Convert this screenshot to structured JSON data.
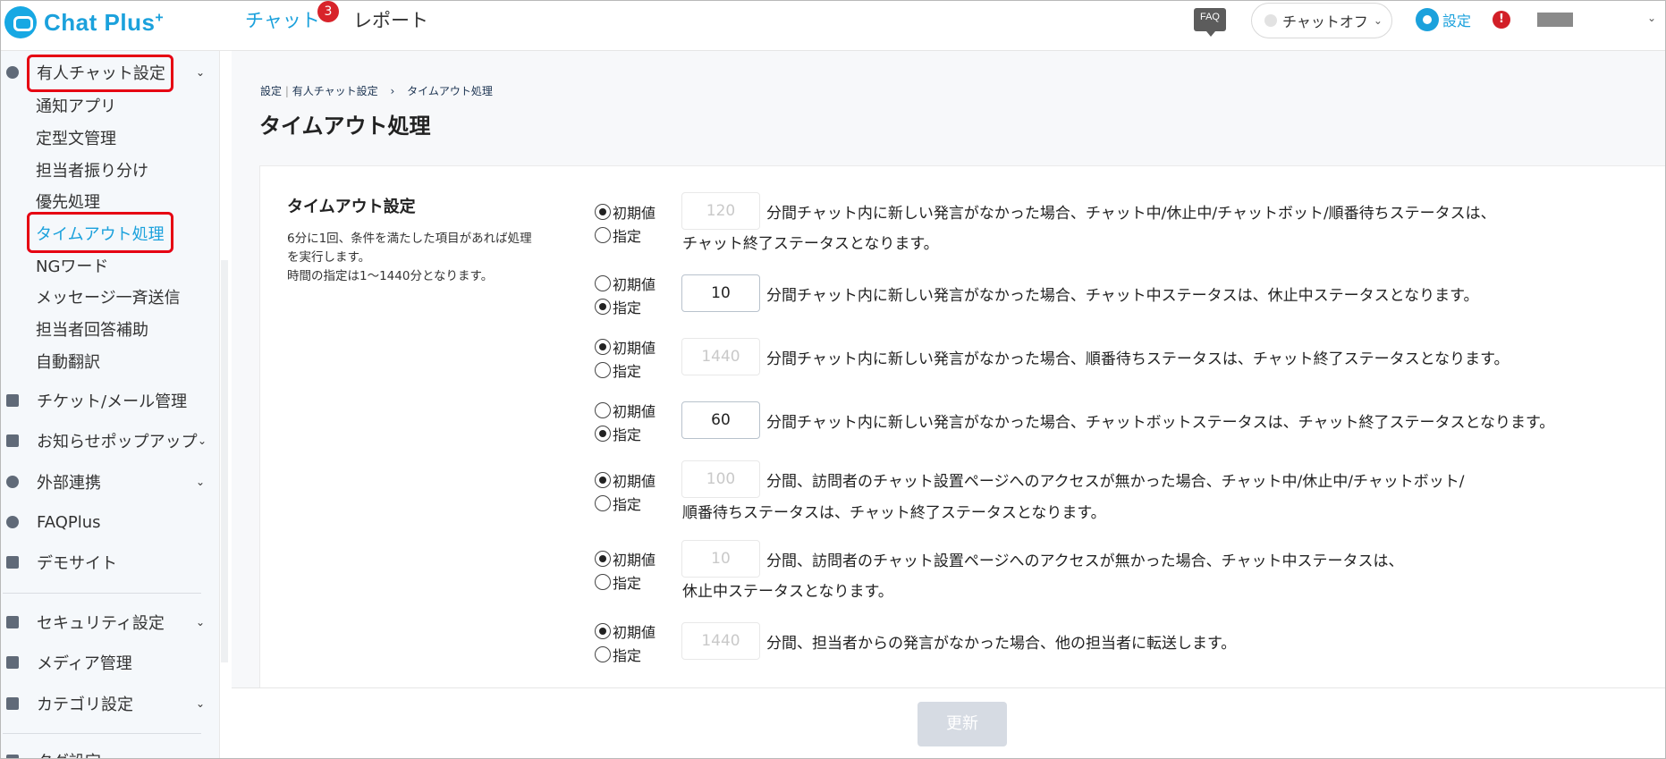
{
  "header": {
    "logo_text": "Chat Plus",
    "logo_plus": "+",
    "nav_chat": "チャット",
    "chat_badge": "3",
    "nav_report": "レポート",
    "faq_label": "FAQ",
    "status_value": "チャットオフ",
    "settings_label": "設定",
    "alert_glyph": "!"
  },
  "sidebar": {
    "group_label": "有人チャット設定",
    "sub_items": [
      "通知アプリ",
      "定型文管理",
      "担当者振り分け",
      "優先処理",
      "タイムアウト処理",
      "NGワード",
      "メッセージ一斉送信",
      "担当者回答補助",
      "自動翻訳"
    ],
    "active_sub": "タイムアウト処理",
    "items": [
      {
        "label": "チケット/メール管理",
        "icon": "ticket-icon"
      },
      {
        "label": "お知らせポップアップ",
        "icon": "popup-icon"
      },
      {
        "label": "外部連携",
        "icon": "share-icon"
      },
      {
        "label": "FAQPlus",
        "icon": "faq-plus-icon"
      },
      {
        "label": "デモサイト",
        "icon": "demo-site-icon"
      },
      {
        "label": "セキュリティ設定",
        "icon": "security-icon"
      },
      {
        "label": "メディア管理",
        "icon": "media-icon"
      },
      {
        "label": "カテゴリ設定",
        "icon": "folder-icon"
      },
      {
        "label": "タグ設定",
        "icon": "tag-icon"
      }
    ]
  },
  "breadcrumb": {
    "part1": "設定",
    "separator": "|",
    "part2": "有人チャット設定",
    "arrow": "›",
    "part3": "タイムアウト処理"
  },
  "page_title": "タイムアウト処理",
  "section": {
    "title": "タイムアウト設定",
    "desc_line1": "6分に1回、条件を満たした項目があれば処理",
    "desc_line2": "を実行します。",
    "desc_line3": "時間の指定は1～1440分となります。"
  },
  "radio_labels": {
    "default": "初期値",
    "custom": "指定"
  },
  "rules": [
    {
      "value": "120",
      "mode": "default",
      "text1": "分間チャット内に新しい発言がなかった場合、チャット中/休止中/チャットボット/順番待ちステータスは、",
      "text2": "チャット終了ステータスとなります。"
    },
    {
      "value": "10",
      "mode": "custom",
      "text1": "分間チャット内に新しい発言がなかった場合、チャット中ステータスは、休止中ステータスとなります。",
      "text2": ""
    },
    {
      "value": "1440",
      "mode": "default",
      "text1": "分間チャット内に新しい発言がなかった場合、順番待ちステータスは、チャット終了ステータスとなります。",
      "text2": ""
    },
    {
      "value": "60",
      "mode": "custom",
      "text1": "分間チャット内に新しい発言がなかった場合、チャットボットステータスは、チャット終了ステータスとなります。",
      "text2": ""
    },
    {
      "value": "100",
      "mode": "default",
      "text1": "分間、訪問者のチャット設置ページへのアクセスが無かった場合、チャット中/休止中/チャットボット/",
      "text2": "順番待ちステータスは、チャット終了ステータスとなります。"
    },
    {
      "value": "10",
      "mode": "default",
      "text1": "分間、訪問者のチャット設置ページへのアクセスが無かった場合、チャット中ステータスは、",
      "text2": "休止中ステータスとなります。"
    },
    {
      "value": "1440",
      "mode": "default",
      "text1": "分間、担当者からの発言がなかった場合、他の担当者に転送します。",
      "text2": ""
    }
  ],
  "update_button": "更新"
}
